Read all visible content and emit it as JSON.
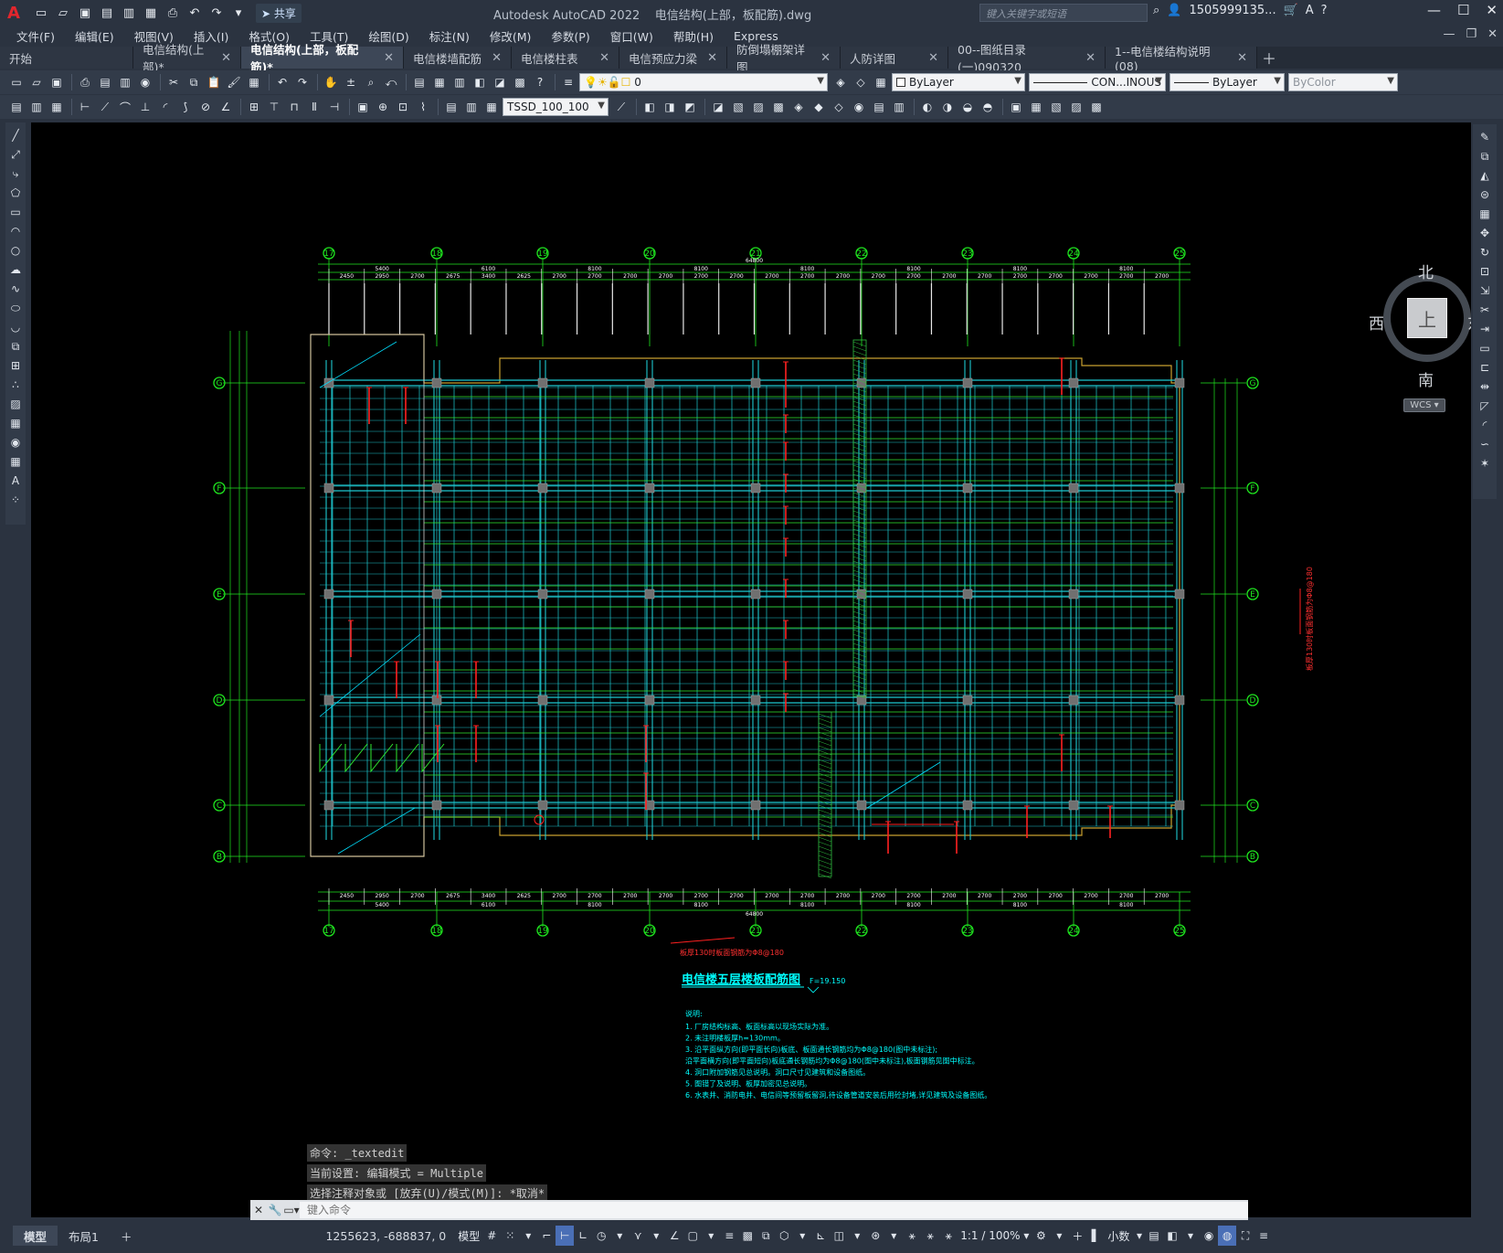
{
  "titlebar": {
    "app_name": "Autodesk AutoCAD 2022",
    "file_name": "电信结构(上部，板配筋).dwg",
    "share_label": "共享",
    "search_placeholder": "键入关键字或短语",
    "user": "1505999135..."
  },
  "menu": [
    "文件(F)",
    "编辑(E)",
    "视图(V)",
    "插入(I)",
    "格式(O)",
    "工具(T)",
    "绘图(D)",
    "标注(N)",
    "修改(M)",
    "参数(P)",
    "窗口(W)",
    "帮助(H)",
    "Express"
  ],
  "tabs": [
    {
      "label": "开始",
      "closable": false,
      "width": 146
    },
    {
      "label": "电信结构(上部)*",
      "closable": true,
      "width": 118
    },
    {
      "label": "电信结构(上部，板配筋)*",
      "closable": true,
      "width": 178,
      "active": true
    },
    {
      "label": "电信楼墙配筋",
      "closable": true,
      "width": 118
    },
    {
      "label": "电信楼柱表",
      "closable": true,
      "width": 118
    },
    {
      "label": "电信预应力梁",
      "closable": true,
      "width": 118
    },
    {
      "label": "防倒塌棚架详图",
      "closable": true,
      "width": 124
    },
    {
      "label": "人防详图",
      "closable": true,
      "width": 118
    },
    {
      "label": "00--图纸目录(一)090320",
      "closable": true,
      "width": 172
    },
    {
      "label": "1--电信楼结构说明(08)",
      "closable": true,
      "width": 166
    }
  ],
  "toolbar": {
    "layer_value": "0",
    "color_value": "ByLayer",
    "linetype_value": "CON...INOUS",
    "lineweight_value": "ByLayer",
    "plotstyle_value": "ByColor",
    "textstyle_value": "TSSD_100_100"
  },
  "viewcube": {
    "north": "北",
    "south": "南",
    "east": "东",
    "west": "西",
    "top": "上",
    "wcs": "WCS"
  },
  "drawing": {
    "title": "电信楼五层楼板配筋图",
    "elevation": "F=19.150",
    "col_axes": [
      "17",
      "18",
      "19",
      "20",
      "21",
      "22",
      "23",
      "24",
      "25"
    ],
    "row_axes": [
      "G",
      "F",
      "E",
      "D",
      "C",
      "B"
    ],
    "top_dims": [
      "2450",
      "2950",
      "2700",
      "2675",
      "3400",
      "2625",
      "2700",
      "2700",
      "2700",
      "2700",
      "2700",
      "2700",
      "2700",
      "2700",
      "2700",
      "2700",
      "2700",
      "2700",
      "2700",
      "2700",
      "2700",
      "2700",
      "2700",
      "2700"
    ],
    "bay_dims": [
      "5400",
      "6100",
      "8100",
      "8100",
      "8100",
      "8100",
      "8100",
      "8100"
    ],
    "total_dim": "64800",
    "side_note": "板厚130时板面钢筋为Φ8@180",
    "bottom_note": "板厚130时板面钢筋为Φ8@180",
    "notes_header": "说明:",
    "notes": [
      "1. 厂房结构标高、板面标高以现场实际为准。",
      "2. 未注明楼板厚h=130mm。",
      "3. 沿平面纵方向(即平面长向)板底、板面通长钢筋均为Φ8@180(图中未标注);",
      "   沿平面横方向(即平面短向)板底通长钢筋均为Φ8@180(图中未标注),板面钢筋见图中标注。",
      "4. 洞口附加钢筋见总说明。洞口尺寸见建筑和设备图纸。",
      "5. 图错了及说明、板厚加密见总说明。",
      "6. 水表井、消防电井、电信间等预留板留洞,待设备管道安装后用砼封堵,详见建筑及设备图纸。"
    ]
  },
  "command": {
    "history": [
      "命令: _textedit",
      "当前设置: 编辑模式 = Multiple",
      "选择注释对象或 [放弃(U)/模式(M)]: *取消*"
    ],
    "placeholder": "键入命令"
  },
  "layout_tabs": [
    "模型",
    "布局1"
  ],
  "status": {
    "coords": "1255623, -688837, 0",
    "model_label": "模型",
    "scale": "1:1 / 100%",
    "units": "小数"
  }
}
